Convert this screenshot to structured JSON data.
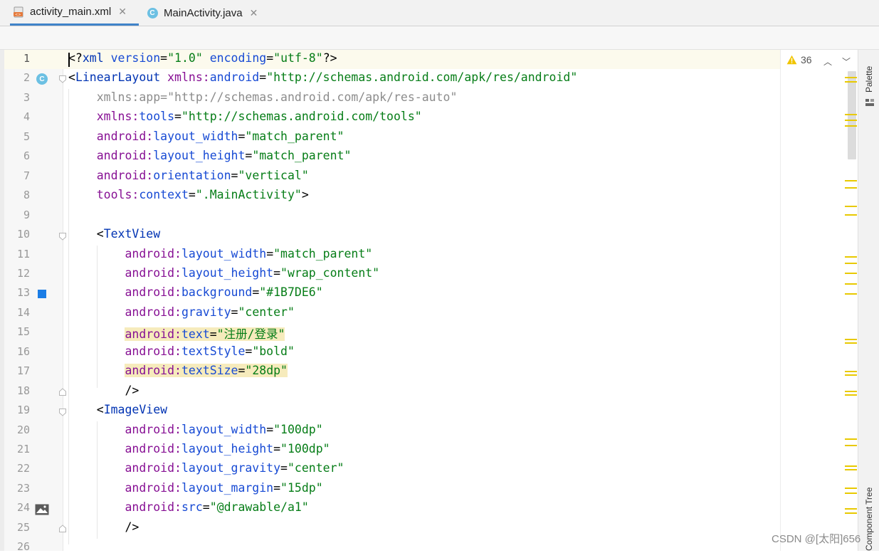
{
  "tabs": [
    {
      "label": "activity_main.xml",
      "icon": "xml-file-icon",
      "active": true
    },
    {
      "label": "MainActivity.java",
      "icon": "java-class-icon",
      "active": false
    }
  ],
  "tab_close_glyph": "✕",
  "inspection": {
    "warning_count": "36"
  },
  "side_panels": {
    "palette": "Palette",
    "component_tree": "Component Tree"
  },
  "watermark": "CSDN @[太阳]656",
  "colors": {
    "tag": "#0033b3",
    "attr_ns": "#871094",
    "attr_name": "#174ad4",
    "value": "#067d17",
    "highlight": "#f6ebbc",
    "accent": "#4083c9",
    "warning": "#e8c900"
  },
  "code_lines": [
    {
      "number": "1",
      "text": "<?xml version=\"1.0\" encoding=\"utf-8\"?>"
    },
    {
      "number": "2",
      "text": "<LinearLayout xmlns:android=\"http://schemas.android.com/apk/res/android\""
    },
    {
      "number": "3",
      "text": "    xmlns:app=\"http://schemas.android.com/apk/res-auto\""
    },
    {
      "number": "4",
      "text": "    xmlns:tools=\"http://schemas.android.com/tools\""
    },
    {
      "number": "5",
      "text": "    android:layout_width=\"match_parent\""
    },
    {
      "number": "6",
      "text": "    android:layout_height=\"match_parent\""
    },
    {
      "number": "7",
      "text": "    android:orientation=\"vertical\""
    },
    {
      "number": "8",
      "text": "    tools:context=\".MainActivity\">"
    },
    {
      "number": "9",
      "text": ""
    },
    {
      "number": "10",
      "text": "    <TextView"
    },
    {
      "number": "11",
      "text": "        android:layout_width=\"match_parent\""
    },
    {
      "number": "12",
      "text": "        android:layout_height=\"wrap_content\""
    },
    {
      "number": "13",
      "text": "        android:background=\"#1B7DE6\""
    },
    {
      "number": "14",
      "text": "        android:gravity=\"center\""
    },
    {
      "number": "15",
      "text": "        android:text=\"注册/登录\""
    },
    {
      "number": "16",
      "text": "        android:textStyle=\"bold\""
    },
    {
      "number": "17",
      "text": "        android:textSize=\"28dp\""
    },
    {
      "number": "18",
      "text": "        />"
    },
    {
      "number": "19",
      "text": "    <ImageView"
    },
    {
      "number": "20",
      "text": "        android:layout_width=\"100dp\""
    },
    {
      "number": "21",
      "text": "        android:layout_height=\"100dp\""
    },
    {
      "number": "22",
      "text": "        android:layout_gravity=\"center\""
    },
    {
      "number": "23",
      "text": "        android:layout_margin=\"15dp\""
    },
    {
      "number": "24",
      "text": "        android:src=\"@drawable/a1\""
    },
    {
      "number": "25",
      "text": "        />"
    },
    {
      "number": "26",
      "text": ""
    }
  ],
  "gutter_marks": {
    "line2": "class-icon",
    "line13": "color-swatch-icon",
    "line24": "image-icon",
    "swatch_color": "#1B7DE6"
  }
}
